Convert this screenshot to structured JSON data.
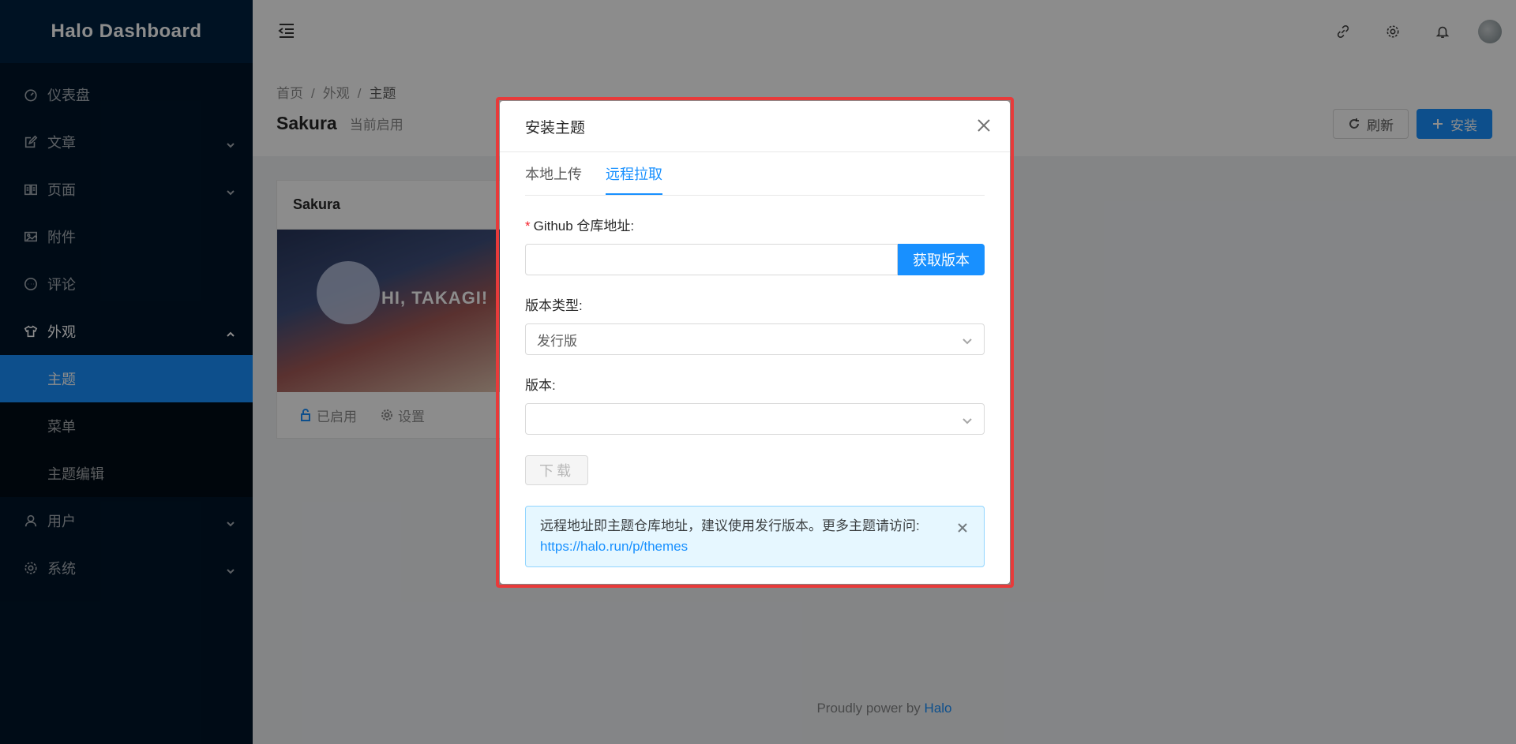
{
  "app": {
    "title": "Halo Dashboard"
  },
  "sidebar": {
    "items": [
      {
        "label": "仪表盘",
        "icon": "dashboard-icon"
      },
      {
        "label": "文章",
        "icon": "edit-icon"
      },
      {
        "label": "页面",
        "icon": "book-icon"
      },
      {
        "label": "附件",
        "icon": "picture-icon"
      },
      {
        "label": "评论",
        "icon": "message-icon"
      },
      {
        "label": "外观",
        "icon": "skin-icon"
      },
      {
        "label": "用户",
        "icon": "user-icon"
      },
      {
        "label": "系统",
        "icon": "setting-icon"
      }
    ],
    "appearance_sub": [
      {
        "label": "主题"
      },
      {
        "label": "菜单"
      },
      {
        "label": "主题编辑"
      }
    ]
  },
  "breadcrumb": [
    "首页",
    "外观",
    "主题"
  ],
  "page": {
    "title": "Sakura",
    "subtitle": "当前启用",
    "refresh_label": "刷新",
    "install_label": "安装"
  },
  "theme_card": {
    "name": "Sakura",
    "cover_text": "HI, TAKAGI!",
    "enabled_label": "已启用",
    "settings_label": "设置"
  },
  "footer": {
    "text": "Proudly power by ",
    "link": "Halo"
  },
  "modal": {
    "title": "安装主题",
    "tabs": [
      "本地上传",
      "远程拉取"
    ],
    "active_tab": "远程拉取",
    "repo_label": "Github 仓库地址:",
    "repo_value": "",
    "fetch_label": "获取版本",
    "version_type_label": "版本类型:",
    "version_type_value": "发行版",
    "version_label": "版本:",
    "version_value": "",
    "download_label": "下载",
    "alert_text": "远程地址即主题仓库地址，建议使用发行版本。更多主题请访问:",
    "alert_link": "https://halo.run/p/themes"
  }
}
